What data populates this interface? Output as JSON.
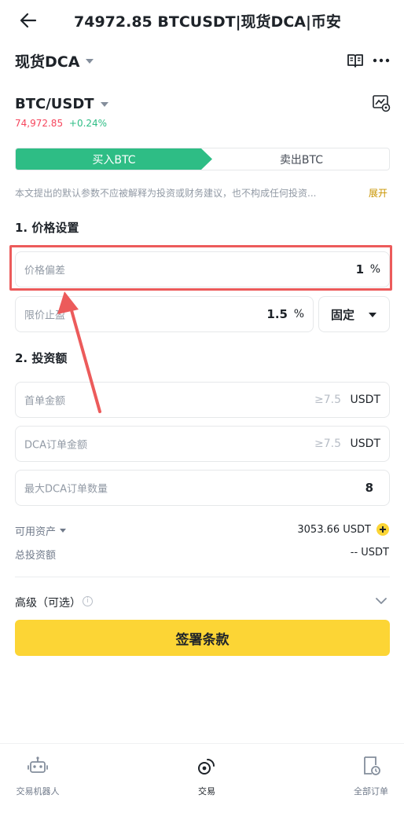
{
  "header": {
    "title": "74972.85 BTCUSDT|现货DCA|币安"
  },
  "mode": {
    "title": "现货DCA"
  },
  "pair": {
    "name": "BTC/USDT",
    "price": "74,972.85",
    "change": "+0.24%"
  },
  "side_tabs": {
    "buy": "买入BTC",
    "sell": "卖出BTC"
  },
  "disclaimer": {
    "text": "本文提出的默认参数不应被解释为投资或财务建议，也不构成任何投资...",
    "expand": "展开"
  },
  "sections": {
    "price": "1. 价格设置",
    "invest": "2. 投资额"
  },
  "fields": {
    "price_deviation": {
      "label": "价格偏差",
      "value": "1",
      "unit": "%"
    },
    "take_profit": {
      "label": "限价止盈",
      "value": "1.5",
      "unit": "%"
    },
    "take_profit_mode": {
      "value": "固定"
    },
    "first_order": {
      "label": "首单金额",
      "hint": "≥7.5",
      "unit": "USDT"
    },
    "dca_order": {
      "label": "DCA订单金额",
      "hint": "≥7.5",
      "unit": "USDT"
    },
    "max_dca_orders": {
      "label": "最大DCA订单数量",
      "value": "8"
    }
  },
  "assets": {
    "available_label": "可用资产",
    "available_value": "3053.66 USDT",
    "total_label": "总投资额",
    "total_value": "-- USDT"
  },
  "advanced": {
    "label": "高级（可选）",
    "info": "i"
  },
  "submit": {
    "label": "签署条款"
  },
  "bottom_nav": {
    "items": [
      {
        "label": "交易机器人"
      },
      {
        "label": "交易"
      },
      {
        "label": "全部订单"
      }
    ]
  },
  "colors": {
    "buy_green": "#2ebd85",
    "price_red": "#f6465d",
    "accent_yellow": "#fcd535",
    "annotation_red": "#ec5b5b"
  },
  "icons": [
    "back-arrow-icon",
    "caret-down-icon",
    "book-icon",
    "more-icon",
    "chart-settings-icon",
    "plus-icon",
    "info-icon",
    "chevron-down-icon",
    "robot-icon",
    "trade-icon",
    "orders-icon"
  ]
}
